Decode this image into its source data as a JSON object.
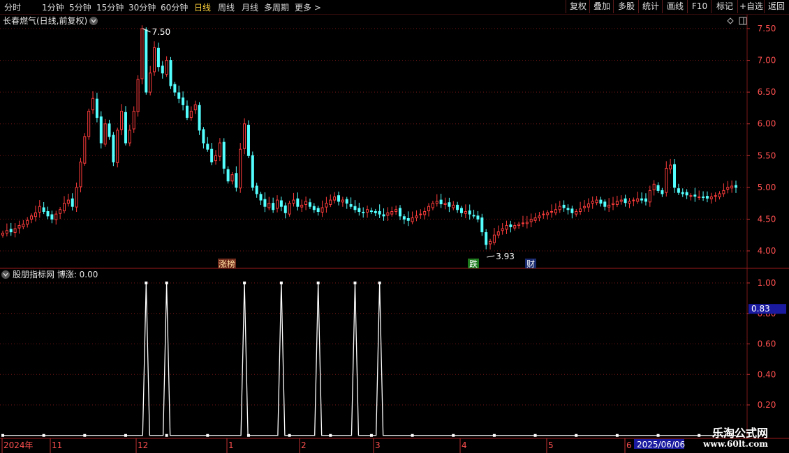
{
  "toolbar": {
    "periods": [
      "分时",
      "1分钟",
      "5分钟",
      "15分钟",
      "30分钟",
      "60分钟",
      "日线",
      "周线",
      "月线",
      "多周期",
      "更多 >"
    ],
    "active": "日线",
    "right_buttons": [
      "复权",
      "叠加",
      "多股",
      "统计",
      "画线",
      "F10",
      "标记",
      "+自选",
      "返回"
    ]
  },
  "price_panel": {
    "title": "长春燃气(日线,前复权)",
    "high_label": "7.50",
    "low_label": "3.93",
    "markers": [
      "涨榜",
      "跌",
      "财"
    ]
  },
  "indicator_panel": {
    "title": "股朋指标网 博涨: 0.00",
    "current_badge": "0.83"
  },
  "footer": {
    "date_badge": "2025/06/06"
  },
  "watermark": {
    "title": "乐淘公式网",
    "url": "www.60lt.com"
  },
  "colors": {
    "up": "#ff3c3c",
    "down": "#54ffff",
    "grid": "#7a1818",
    "indicator": "#ffffff",
    "active_tab": "#ffd23c"
  },
  "chart_data": [
    {
      "type": "candlestick",
      "yticks": [
        4.0,
        4.5,
        5.0,
        5.5,
        6.0,
        6.5,
        7.0,
        7.5
      ],
      "ylim": [
        3.75,
        7.6
      ],
      "grid": true,
      "x_labels": [
        "2024年",
        "11",
        "12",
        "1",
        "2",
        "3",
        "4",
        "5",
        "6"
      ],
      "closes": [
        4.28,
        4.32,
        4.3,
        4.35,
        4.4,
        4.42,
        4.48,
        4.55,
        4.6,
        4.7,
        4.62,
        4.55,
        4.5,
        4.58,
        4.65,
        4.75,
        4.8,
        4.7,
        5.0,
        5.4,
        5.8,
        6.2,
        6.4,
        6.1,
        5.7,
        6.0,
        5.8,
        5.4,
        5.9,
        6.2,
        5.7,
        5.9,
        6.2,
        6.7,
        7.5,
        6.5,
        6.8,
        7.2,
        6.9,
        6.8,
        7.0,
        6.6,
        6.5,
        6.4,
        6.3,
        6.1,
        6.2,
        6.3,
        5.9,
        5.7,
        5.6,
        5.4,
        5.5,
        5.7,
        5.3,
        5.1,
        5.2,
        5.0,
        5.6,
        6.0,
        5.5,
        5.0,
        4.9,
        4.8,
        4.7,
        4.75,
        4.65,
        4.8,
        4.7,
        4.6,
        4.75,
        4.8,
        4.7,
        4.72,
        4.78,
        4.7,
        4.65,
        4.62,
        4.68,
        4.75,
        4.8,
        4.85,
        4.78,
        4.8,
        4.75,
        4.7,
        4.65,
        4.62,
        4.6,
        4.65,
        4.62,
        4.6,
        4.58,
        4.55,
        4.6,
        4.62,
        4.65,
        4.55,
        4.5,
        4.48,
        4.52,
        4.55,
        4.58,
        4.62,
        4.7,
        4.75,
        4.78,
        4.74,
        4.75,
        4.7,
        4.72,
        4.65,
        4.6,
        4.62,
        4.58,
        4.55,
        4.5,
        4.3,
        4.1,
        4.15,
        4.25,
        4.3,
        4.35,
        4.4,
        4.38,
        4.4,
        4.42,
        4.44,
        4.45,
        4.5,
        4.52,
        4.55,
        4.58,
        4.6,
        4.62,
        4.65,
        4.7,
        4.68,
        4.65,
        4.6,
        4.62,
        4.66,
        4.7,
        4.74,
        4.78,
        4.8,
        4.75,
        4.7,
        4.72,
        4.75,
        4.78,
        4.8,
        4.76,
        4.78,
        4.8,
        4.82,
        4.8,
        4.78,
        4.95,
        5.05,
        4.95,
        4.9,
        5.3,
        5.35,
        5.0,
        4.92,
        4.9,
        4.88,
        4.87,
        4.86,
        4.85,
        4.84,
        4.83,
        4.85,
        4.87,
        4.9,
        4.95,
        5.0,
        5.02,
        5.0
      ]
    },
    {
      "type": "line",
      "series": [
        {
          "name": "博涨",
          "value_now": 0.0
        }
      ],
      "yticks": [
        0.2,
        0.4,
        0.6,
        0.8,
        1.0
      ],
      "ylim": [
        0,
        1.05
      ],
      "spike_indices": [
        35,
        40,
        59,
        68,
        77,
        86,
        92
      ],
      "grid": true
    }
  ]
}
